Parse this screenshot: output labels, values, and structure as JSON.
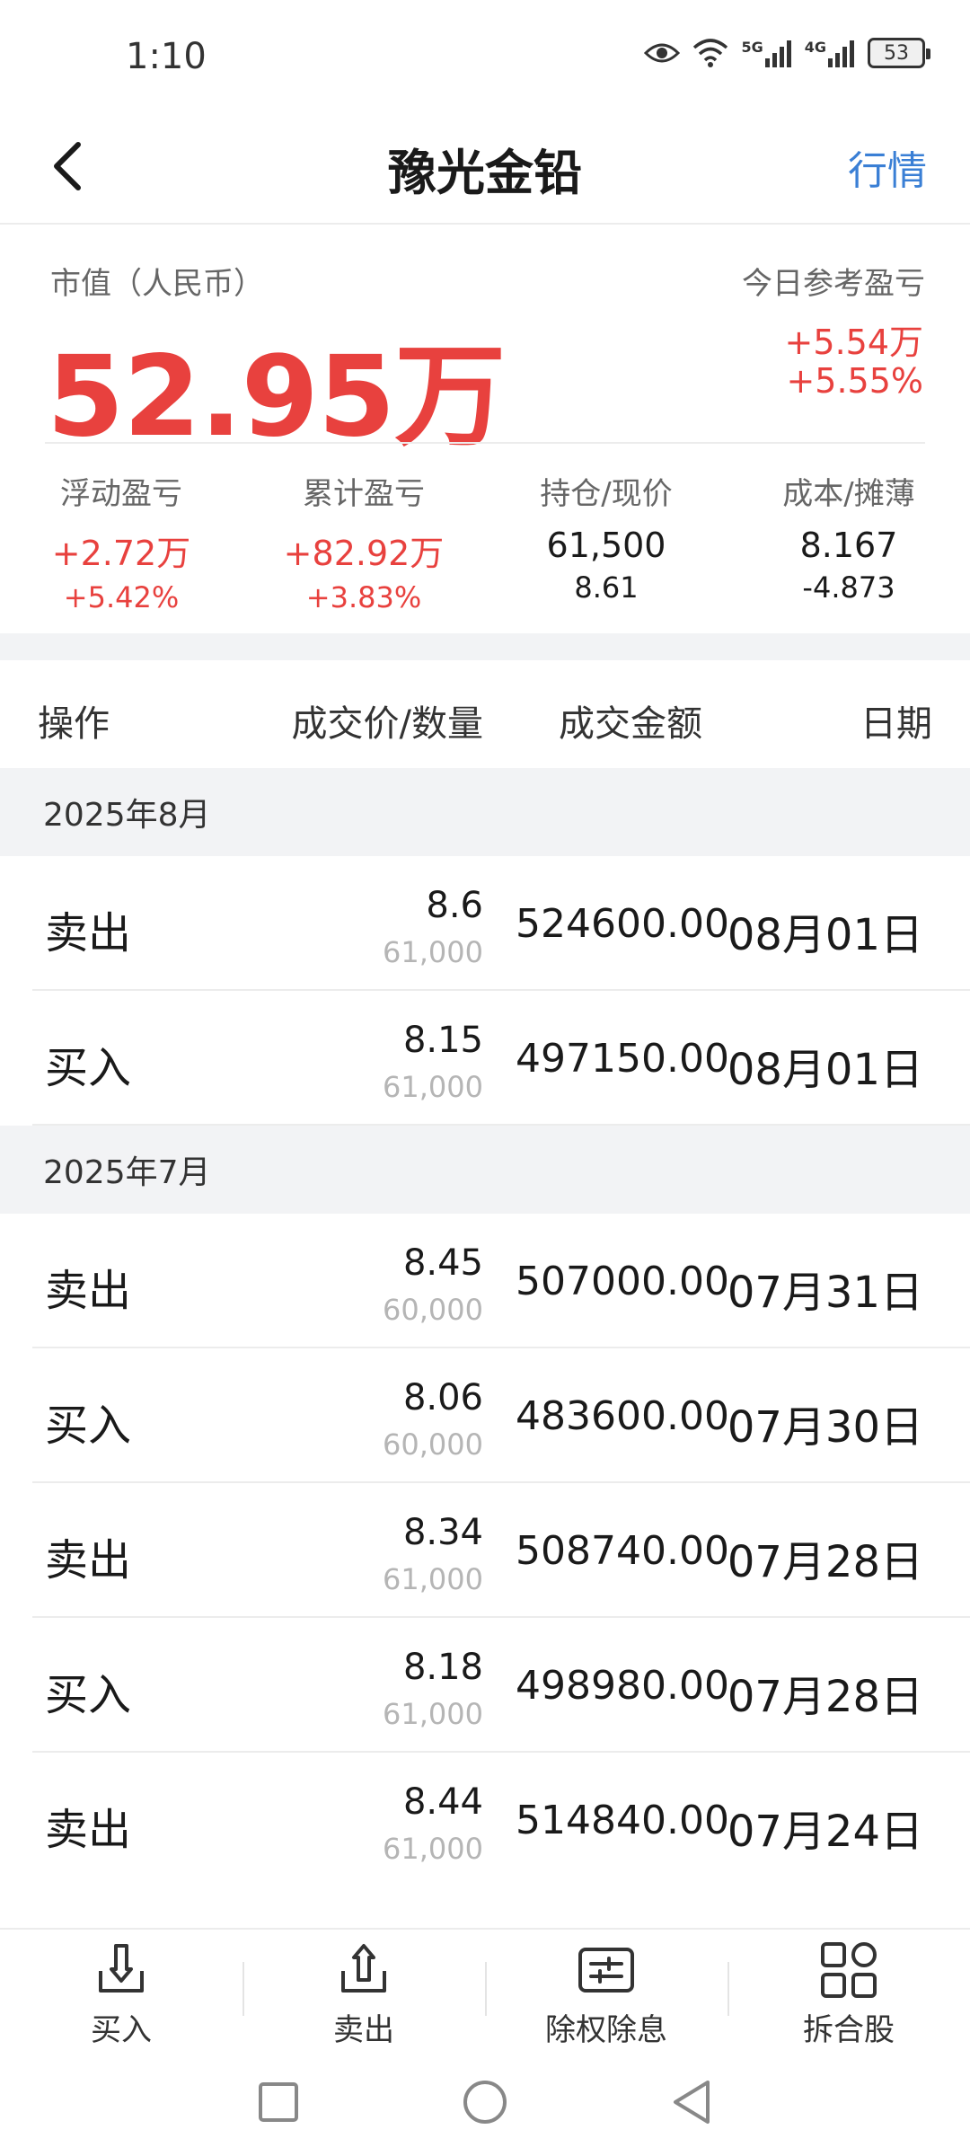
{
  "status_bar": {
    "time": "1:10",
    "sig1_label": "5G",
    "sig2_label": "4G",
    "battery": "53"
  },
  "header": {
    "title": "豫光金铅",
    "right_link": "行情"
  },
  "summary": {
    "market_value_label": "市值（人民币）",
    "market_value": "52.95万",
    "today_label": "今日参考盈亏",
    "today_amount": "+5.54万",
    "today_pct": "+5.55%",
    "stats": [
      {
        "label": "浮动盈亏",
        "main": "+2.72万",
        "sub": "+5.42%"
      },
      {
        "label": "累计盈亏",
        "main": "+82.92万",
        "sub": "+3.83%"
      },
      {
        "label": "持仓/现价",
        "main": "61,500",
        "sub": "8.61"
      },
      {
        "label": "成本/摊薄",
        "main": "8.167",
        "sub": "-4.873"
      }
    ]
  },
  "table": {
    "headers": {
      "op": "操作",
      "price_qty": "成交价/数量",
      "amount": "成交金额",
      "date": "日期"
    },
    "months": [
      {
        "label": "2025年8月",
        "rows": [
          {
            "op": "卖出",
            "price": "8.6",
            "qty": "61,000",
            "amount": "524600.00",
            "date": "08月01日"
          },
          {
            "op": "买入",
            "price": "8.15",
            "qty": "61,000",
            "amount": "497150.00",
            "date": "08月01日"
          }
        ]
      },
      {
        "label": "2025年7月",
        "rows": [
          {
            "op": "卖出",
            "price": "8.45",
            "qty": "60,000",
            "amount": "507000.00",
            "date": "07月31日"
          },
          {
            "op": "买入",
            "price": "8.06",
            "qty": "60,000",
            "amount": "483600.00",
            "date": "07月30日"
          },
          {
            "op": "卖出",
            "price": "8.34",
            "qty": "61,000",
            "amount": "508740.00",
            "date": "07月28日"
          },
          {
            "op": "买入",
            "price": "8.18",
            "qty": "61,000",
            "amount": "498980.00",
            "date": "07月28日"
          },
          {
            "op": "卖出",
            "price": "8.44",
            "qty": "61,000",
            "amount": "514840.00",
            "date": "07月24日"
          }
        ]
      }
    ]
  },
  "toolbar": {
    "buy": "买入",
    "sell": "卖出",
    "dividend": "除权除息",
    "split": "拆合股"
  },
  "colors": {
    "gain": "#e8413e",
    "link": "#3a7fd5",
    "muted": "#b5b5b5"
  }
}
